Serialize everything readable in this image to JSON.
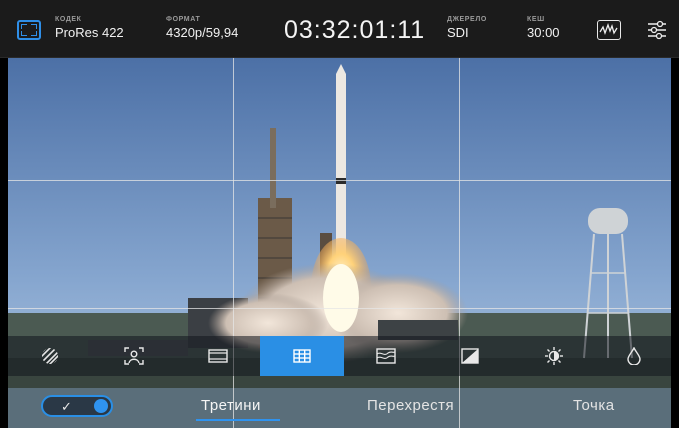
{
  "status_bar": {
    "codec": {
      "label": "КОДЕК",
      "value": "ProRes 422"
    },
    "format": {
      "label": "ФОРМАТ",
      "value": "4320p/59,94"
    },
    "timecode": "03:32:01:11",
    "source": {
      "label": "ДЖЕРЕЛО",
      "value": "SDI"
    },
    "cache": {
      "label": "КЕШ",
      "value": "30:00"
    },
    "icons": [
      "frame-guides-icon",
      "waveform-scope-icon",
      "settings-sliders-icon"
    ]
  },
  "overlay_toolbar": {
    "tools": [
      {
        "name": "zebra",
        "icon": "zebra-icon"
      },
      {
        "name": "focus-assist",
        "icon": "focus-assist-icon"
      },
      {
        "name": "frame-guides",
        "icon": "frame-guides-icon"
      },
      {
        "name": "grids",
        "icon": "grid-icon",
        "active": true
      },
      {
        "name": "false-color",
        "icon": "false-color-icon"
      },
      {
        "name": "lut",
        "icon": "lut-icon"
      },
      {
        "name": "exposure",
        "icon": "exposure-icon"
      },
      {
        "name": "color",
        "icon": "droplet-icon"
      }
    ]
  },
  "grid_options": {
    "enabled": true,
    "tabs": [
      {
        "label": "Третини",
        "active": true
      },
      {
        "label": "Перехрестя",
        "active": false
      },
      {
        "label": "Точка",
        "active": false
      }
    ]
  },
  "colors": {
    "accent": "#2a8fe5",
    "topbar": "#1b1b1b",
    "sky_top": "#5275a8",
    "sky_bottom": "#a8c0dc"
  }
}
